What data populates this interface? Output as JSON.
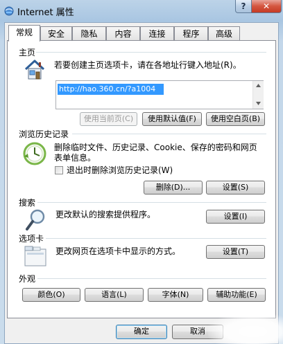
{
  "window": {
    "title": "Internet 属性",
    "help_label": "?",
    "close_label": "✕"
  },
  "tabs": [
    {
      "label": "常规",
      "active": true
    },
    {
      "label": "安全"
    },
    {
      "label": "隐私"
    },
    {
      "label": "内容"
    },
    {
      "label": "连接"
    },
    {
      "label": "程序"
    },
    {
      "label": "高级"
    }
  ],
  "home": {
    "title": "主页",
    "description": "若要创建主页选项卡，请在各地址行键入地址(R)。",
    "url_value": "http://hao.360.cn/?a1004",
    "btn_use_current": "使用当前页(C)",
    "btn_use_default": "使用默认值(F)",
    "btn_use_blank": "使用空白页(B)"
  },
  "history": {
    "title": "浏览历史记录",
    "description_line1": "删除临时文件、历史记录、Cookie、保存的密码和网页",
    "description_line2": "表单信息。",
    "checkbox_label": "退出时删除浏览历史记录(W)",
    "btn_delete": "删除(D)...",
    "btn_settings": "设置(S)"
  },
  "search": {
    "title": "搜索",
    "description": "更改默认的搜索提供程序。",
    "btn_settings": "设置(I)"
  },
  "tabs_section": {
    "title": "选项卡",
    "description": "更改网页在选项卡中显示的方式。",
    "btn_settings": "设置(T)"
  },
  "appearance": {
    "title": "外观",
    "btn_colors": "颜色(O)",
    "btn_languages": "语言(L)",
    "btn_fonts": "字体(N)",
    "btn_accessibility": "辅助功能(E)"
  },
  "footer": {
    "ok": "确定",
    "cancel": "取消"
  }
}
